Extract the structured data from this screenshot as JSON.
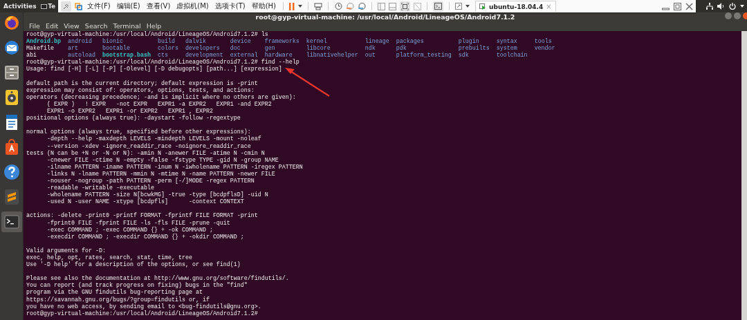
{
  "top_panel": {
    "activities": "Activities",
    "app_menu": "Te"
  },
  "vm_toolbar": {
    "menus": [
      "文件(F)",
      "编辑(E)",
      "查看(V)",
      "虚拟机(M)",
      "选项卡(T)",
      "帮助(H)"
    ],
    "tab": {
      "label": "ubuntu-18.04.4",
      "close": "×"
    }
  },
  "dock": [
    {
      "kind": "browser",
      "selected": false
    },
    {
      "kind": "mail",
      "selected": false
    },
    {
      "kind": "files",
      "selected": false
    },
    {
      "kind": "music",
      "selected": false
    },
    {
      "kind": "document",
      "selected": false
    },
    {
      "kind": "store",
      "selected": false
    },
    {
      "kind": "help",
      "selected": false
    },
    {
      "kind": "editor",
      "selected": false
    },
    {
      "kind": "terminal",
      "selected": true
    }
  ],
  "terminal": {
    "title": "root@gyp-virtual-machine: /usr/local/Android/LineageOS/Android7.1.2",
    "menu": [
      "File",
      "Edit",
      "View",
      "Search",
      "Terminal",
      "Help"
    ],
    "session": [
      {
        "kind": "command",
        "prompt": "root@gyp-virtual-machine:/usr/local/Android/LineageOS/Android7.1.2#",
        "command": "ls"
      },
      {
        "kind": "listing",
        "rows": [
          [
            {
              "name": "Android.bp",
              "kind": "link"
            },
            {
              "name": "android",
              "kind": "dir"
            },
            {
              "name": "bionic",
              "kind": "dir"
            },
            {
              "name": "build",
              "kind": "dir"
            },
            {
              "name": "dalvik",
              "kind": "dir"
            },
            {
              "name": "device",
              "kind": "dir"
            },
            {
              "name": "frameworks",
              "kind": "dir"
            },
            {
              "name": "kernel",
              "kind": "dir"
            },
            {
              "name": "lineage",
              "kind": "dir"
            },
            {
              "name": "packages",
              "kind": "dir"
            },
            {
              "name": "plugin",
              "kind": "dir"
            },
            {
              "name": "syntax",
              "kind": "dir"
            },
            {
              "name": "tools",
              "kind": "dir"
            }
          ],
          [
            {
              "name": "Makefile",
              "kind": "file"
            },
            {
              "name": "art",
              "kind": "dir"
            },
            {
              "name": "bootable",
              "kind": "dir"
            },
            {
              "name": "colors",
              "kind": "dir"
            },
            {
              "name": "developers",
              "kind": "dir"
            },
            {
              "name": "doc",
              "kind": "dir"
            },
            {
              "name": "gen",
              "kind": "dir"
            },
            {
              "name": "libcore",
              "kind": "dir"
            },
            {
              "name": "ndk",
              "kind": "dir"
            },
            {
              "name": "pdk",
              "kind": "dir"
            },
            {
              "name": "prebuilts",
              "kind": "dir"
            },
            {
              "name": "system",
              "kind": "dir"
            },
            {
              "name": "vendor",
              "kind": "dir"
            }
          ],
          [
            {
              "name": "abi",
              "kind": "file"
            },
            {
              "name": "autoload",
              "kind": "dir"
            },
            {
              "name": "bootstrap.bash",
              "kind": "link"
            },
            {
              "name": "cts",
              "kind": "dir"
            },
            {
              "name": "development",
              "kind": "dir"
            },
            {
              "name": "external",
              "kind": "dir"
            },
            {
              "name": "hardware",
              "kind": "dir"
            },
            {
              "name": "libnativehelper",
              "kind": "dir"
            },
            {
              "name": "out",
              "kind": "dir"
            },
            {
              "name": "platform_testing",
              "kind": "dir"
            },
            {
              "name": "sdk",
              "kind": "dir"
            },
            {
              "name": "toolchain",
              "kind": "dir"
            }
          ]
        ]
      },
      {
        "kind": "command",
        "prompt": "root@gyp-virtual-machine:/usr/local/Android/LineageOS/Android7.1.2#",
        "command": "find --help"
      },
      {
        "kind": "output",
        "paragraphs": [
          [
            "Usage: find [-H] [-L] [-P] [-Olevel] [-D debugopts] [path...] [expression]"
          ],
          [
            "default path is the current directory; default expression is -print",
            "expression may consist of: operators, options, tests, and actions:",
            "operators (decreasing precedence; -and is implicit where no others are given):",
            "      ( EXPR )   ! EXPR   -not EXPR   EXPR1 -a EXPR2   EXPR1 -and EXPR2",
            "      EXPR1 -o EXPR2   EXPR1 -or EXPR2   EXPR1 , EXPR2",
            "positional options (always true): -daystart -follow -regextype"
          ],
          [
            "normal options (always true, specified before other expressions):",
            "      -depth --help -maxdepth LEVELS -mindepth LEVELS -mount -noleaf",
            "      --version -xdev -ignore_readdir_race -noignore_readdir_race",
            "tests (N can be +N or -N or N): -amin N -anewer FILE -atime N -cmin N",
            "      -cnewer FILE -ctime N -empty -false -fstype TYPE -gid N -group NAME",
            "      -ilname PATTERN -iname PATTERN -inum N -iwholename PATTERN -iregex PATTERN",
            "      -links N -lname PATTERN -mmin N -mtime N -name PATTERN -newer FILE",
            "      -nouser -nogroup -path PATTERN -perm [-/]MODE -regex PATTERN",
            "      -readable -writable -executable",
            "      -wholename PATTERN -size N[bcwkMG] -true -type [bcdpflsD] -uid N",
            "      -used N -user NAME -xtype [bcdpfls]      -context CONTEXT"
          ],
          [
            "actions: -delete -print0 -printf FORMAT -fprintf FILE FORMAT -print",
            "      -fprint0 FILE -fprint FILE -ls -fls FILE -prune -quit",
            "      -exec COMMAND ; -exec COMMAND {} + -ok COMMAND ;",
            "      -execdir COMMAND ; -execdir COMMAND {} + -okdir COMMAND ;"
          ],
          [
            "Valid arguments for -D:",
            "exec, help, opt, rates, search, stat, time, tree",
            "Use '-D help' for a description of the options, or see find(1)"
          ],
          [
            "Please see also the documentation at http://www.gnu.org/software/findutils/.",
            "You can report (and track progress on fixing) bugs in the \"find\"",
            "program via the GNU findutils bug-reporting page at",
            "https://savannah.gnu.org/bugs/?group=findutils or, if",
            "you have no web access, by sending email to <bug-findutils@gnu.org>."
          ]
        ]
      },
      {
        "kind": "command",
        "prompt": "root@gyp-virtual-machine:/usr/local/Android/LineageOS/Android7.1.2#"
      }
    ]
  }
}
